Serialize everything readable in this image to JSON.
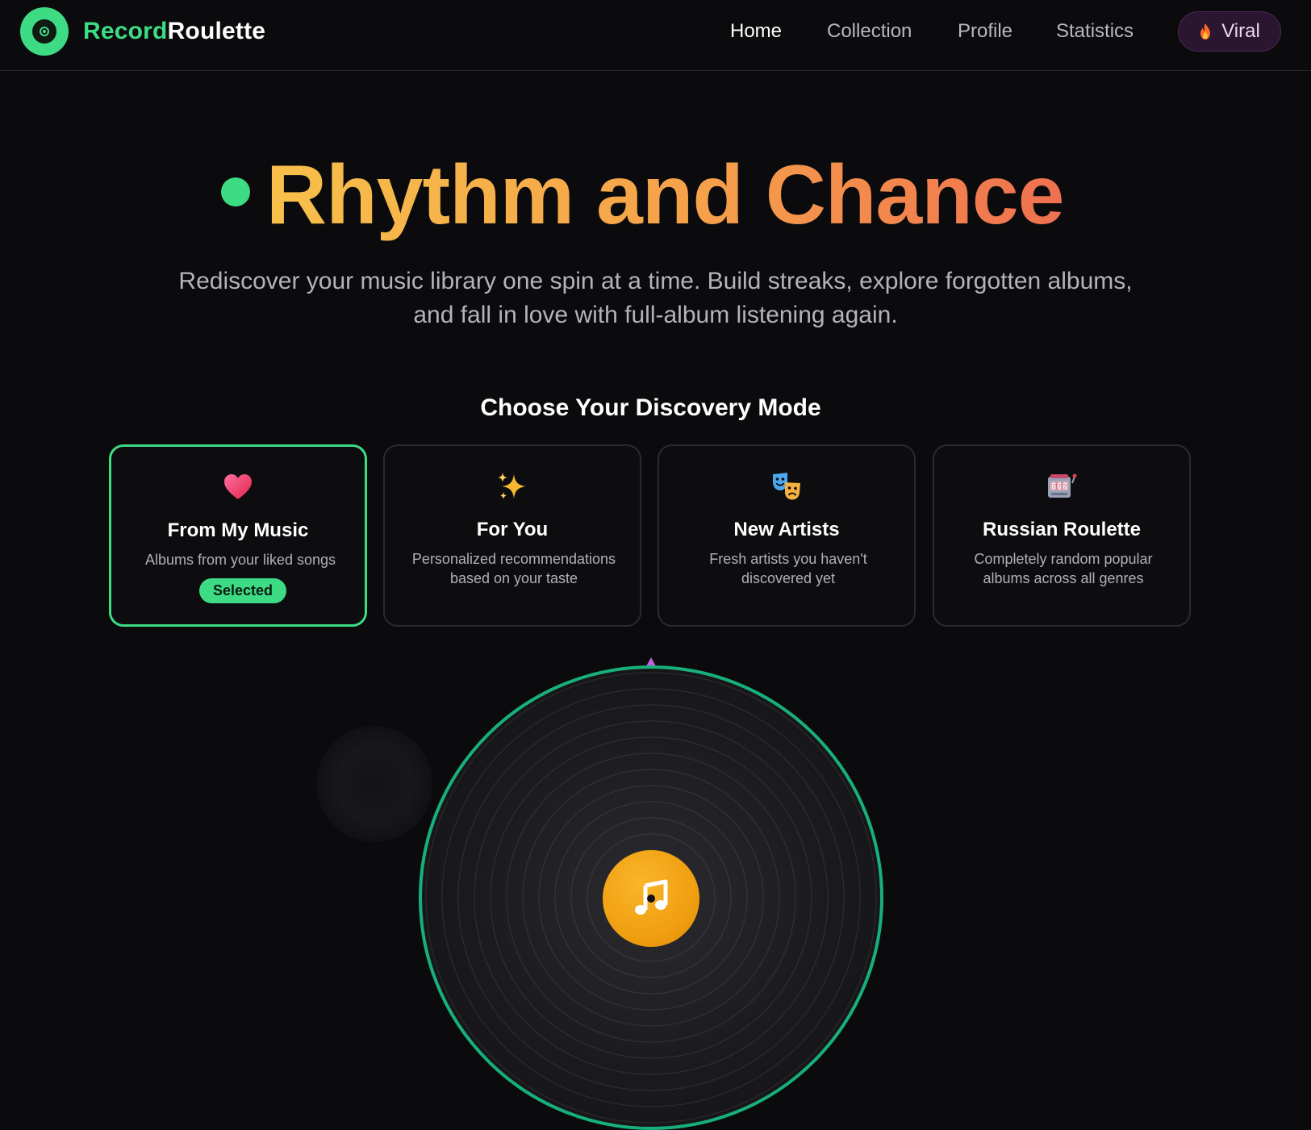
{
  "brand": {
    "name_part1": "Record",
    "name_part2": "Roulette"
  },
  "nav": {
    "home": "Home",
    "collection": "Collection",
    "profile": "Profile",
    "statistics": "Statistics",
    "viral": "Viral",
    "active": "Home"
  },
  "hero": {
    "title": "Rhythm and Chance",
    "subtitle": "Rediscover your music library one spin at a time. Build streaks, explore forgotten albums, and fall in love with full-album listening again."
  },
  "modes": {
    "heading": "Choose Your Discovery Mode",
    "items": [
      {
        "icon": "heart-icon",
        "title": "From My Music",
        "description": "Albums from your liked songs",
        "selected": true,
        "badge": "Selected"
      },
      {
        "icon": "sparkles-icon",
        "title": "For You",
        "description": "Personalized recommendations based on your taste",
        "selected": false
      },
      {
        "icon": "theater-masks-icon",
        "title": "New Artists",
        "description": "Fresh artists you haven't discovered yet",
        "selected": false
      },
      {
        "icon": "slot-machine-icon",
        "title": "Russian Roulette",
        "description": "Completely random popular albums across all genres",
        "selected": false
      }
    ]
  },
  "record": {
    "center_icon": "music-note-icon"
  },
  "colors": {
    "accent": "#3ddc84",
    "record_ring": "#18b07a",
    "title_gradient_start": "#f7c04a",
    "title_gradient_end": "#ef7050",
    "label": "#f0a010",
    "viral_bg": "#2a1630",
    "pointer": "#c85ce0"
  }
}
